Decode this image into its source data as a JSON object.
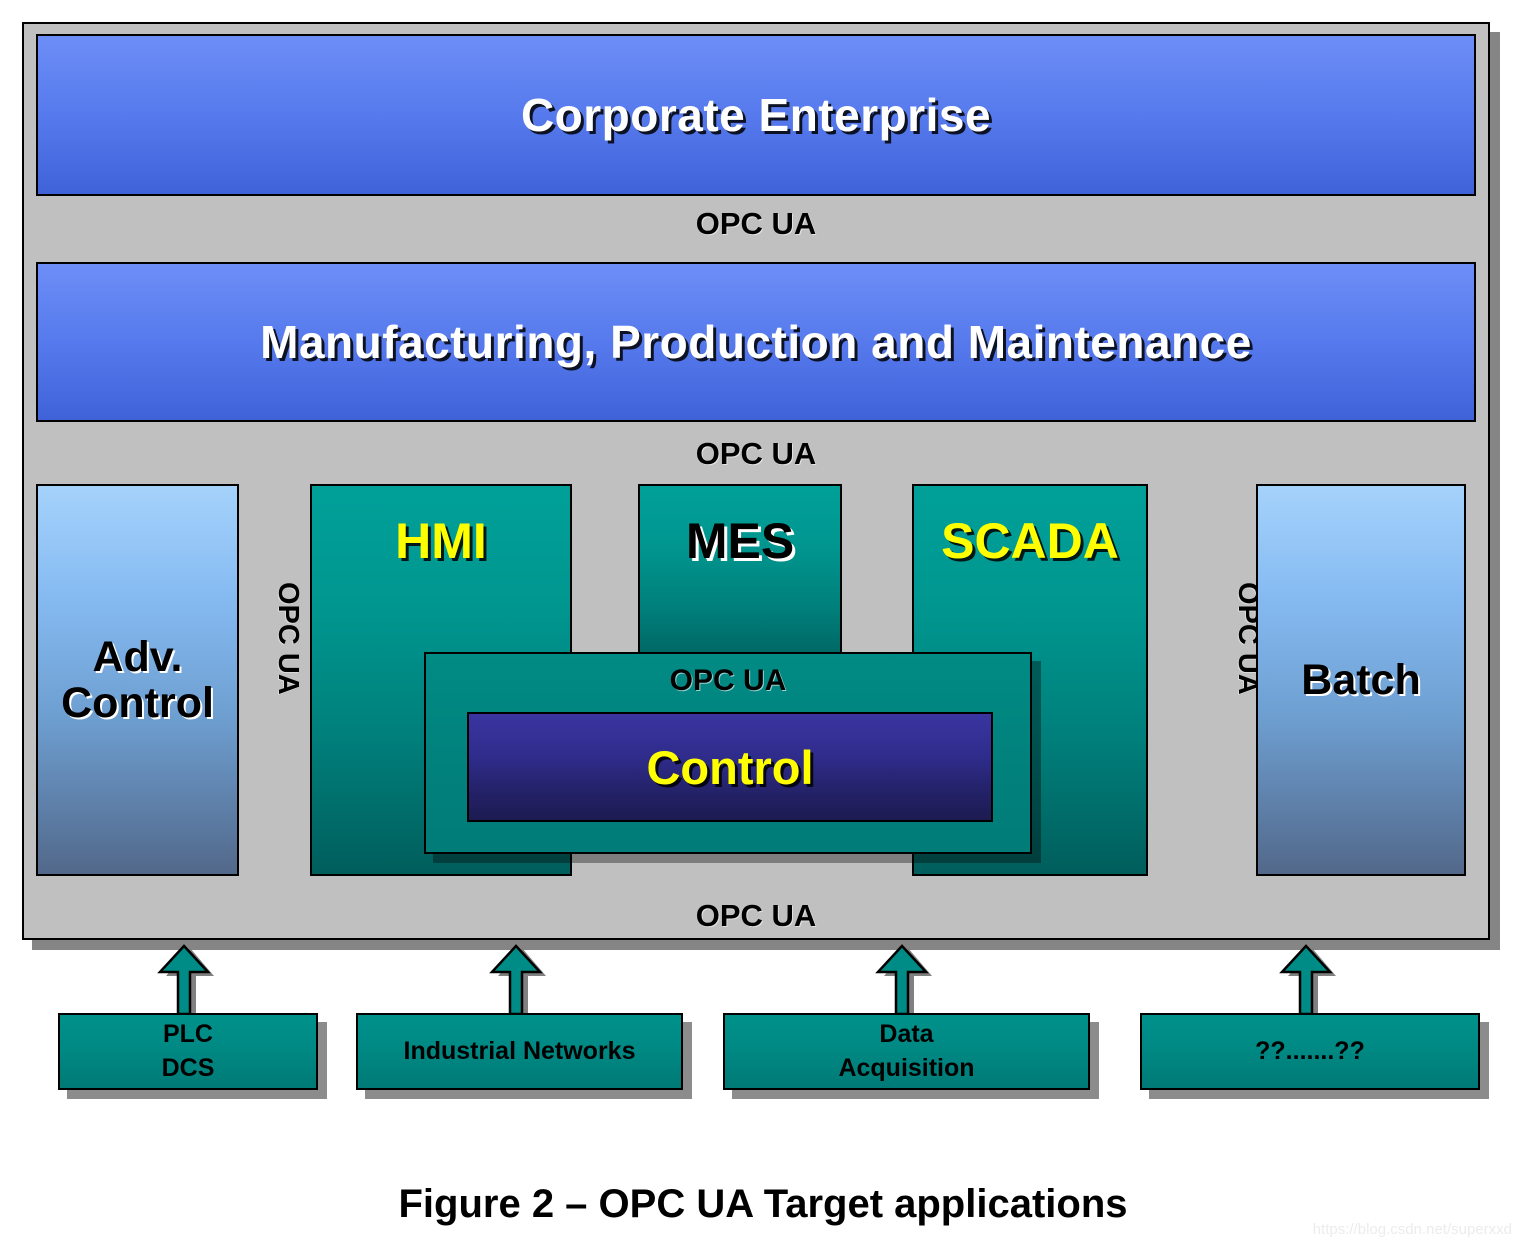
{
  "figure": {
    "caption": "Figure 2 – OPC UA Target applications",
    "watermark": "https://blog.csdn.net/superxxd"
  },
  "layers": {
    "corporate": {
      "label": "Corporate Enterprise"
    },
    "manufacturing": {
      "label": "Manufacturing, Production and Maintenance"
    }
  },
  "connectors": {
    "top": "OPC UA",
    "middle": "OPC UA",
    "bottom": "OPC UA",
    "left_vertical": "OPC UA",
    "right_vertical": "OPC UA",
    "control_panel": "OPC UA"
  },
  "applications": {
    "adv_control": {
      "label": "Adv.\nControl"
    },
    "hmi": {
      "label": "HMI"
    },
    "mes": {
      "label": "MES"
    },
    "scada": {
      "label": "SCADA"
    },
    "batch": {
      "label": "Batch"
    },
    "control": {
      "label": "Control"
    }
  },
  "sources": [
    {
      "label": "PLC\nDCS"
    },
    {
      "label": "Industrial Networks"
    },
    {
      "label": "Data\nAcquisition"
    },
    {
      "label": "??.......??"
    }
  ],
  "colors": {
    "frame_gray": "#c0c0c0",
    "blue_bar_top": "#6d8ef7",
    "blue_bar_bottom": "#4062d8",
    "teal_top": "#00a099",
    "teal_bottom": "#005e5c",
    "control_blue_top": "#3a35a0",
    "control_blue_bottom": "#1d1b51",
    "highlight_yellow": "#ffff00",
    "side_box_top": "#a5d2fb",
    "side_box_bottom": "#52688a"
  }
}
